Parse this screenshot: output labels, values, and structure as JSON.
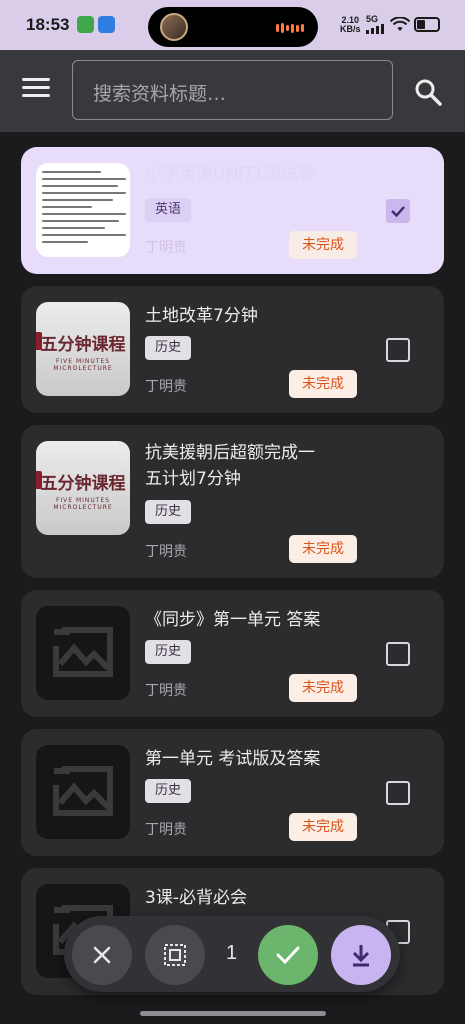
{
  "status_bar": {
    "time": "18:53",
    "network_speed": "2.10",
    "network_unit": "KB/s",
    "network_type": "5G",
    "icons": [
      "app-icon-green",
      "app-icon-blue",
      "signal-icon",
      "wifi-icon",
      "battery-icon"
    ]
  },
  "app_bar": {
    "search_placeholder": "搜索资料标题…",
    "menu_icon": "menu-icon",
    "search_icon": "search-icon"
  },
  "items": [
    {
      "title": "小学英语UNIT1测试卷",
      "subject": "英语",
      "author": "丁明贵",
      "status": "未完成",
      "thumb": "document",
      "checked": true
    },
    {
      "title": "土地改革7分钟",
      "subject": "历史",
      "author": "丁明贵",
      "status": "未完成",
      "thumb": "lecture",
      "checked": false
    },
    {
      "title": "抗美援朝后超额完成一\n五计划7分钟",
      "title_line1": "抗美援朝后超额完成一",
      "title_line2": "五计划7分钟",
      "subject": "历史",
      "author": "丁明贵",
      "status": "未完成",
      "thumb": "lecture",
      "checked": false
    },
    {
      "title": "《同步》第一单元  答案",
      "subject": "历史",
      "author": "丁明贵",
      "status": "未完成",
      "thumb": "placeholder",
      "checked": false
    },
    {
      "title": "第一单元 考试版及答案",
      "subject": "历史",
      "author": "丁明贵",
      "status": "未完成",
      "thumb": "placeholder",
      "checked": false
    },
    {
      "title": "3课-必背必会",
      "subject": "",
      "author": "",
      "status": "",
      "thumb": "placeholder",
      "checked": false
    }
  ],
  "lecture_thumb": {
    "text": "五分钟课程",
    "subtext": "FIVE MINUTES MICROLECTURE"
  },
  "bottom_bar": {
    "selected_count": "1",
    "icons": [
      "close-icon",
      "select-all-icon",
      "confirm-icon",
      "download-icon"
    ]
  },
  "colors": {
    "accent": "#c7b4f1",
    "confirm": "#6bb56d",
    "status_text": "#d9541c"
  }
}
